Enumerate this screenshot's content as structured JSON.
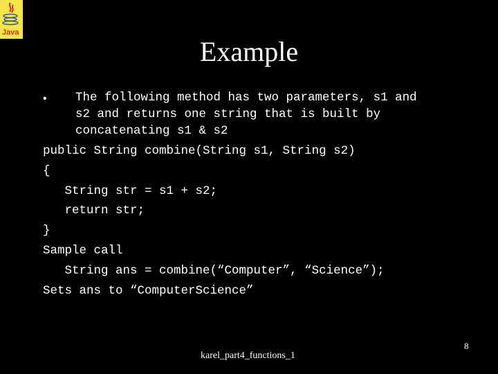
{
  "slide": {
    "title": "Example",
    "bullet": {
      "symbol": "•",
      "lines": [
        "The following method has two parameters, s1 and",
        "s2 and returns one string that is built by",
        "concatenating s1 & s2"
      ]
    },
    "code_lines": [
      "public String combine(String s1, String s2)",
      "{",
      "   String str = s1 + s2;",
      "   return str;",
      "}",
      "Sample call",
      "   String ans = combine(“Computer”, “Science”);",
      "Sets ans to “ComputerScience”"
    ],
    "footer": "karel_part4_functions_1",
    "page_number": "8"
  },
  "logo": {
    "label": "Java",
    "colors": {
      "background": "#f4e64a",
      "accent": "#d0311f",
      "cup": "#3a5a8a"
    }
  }
}
